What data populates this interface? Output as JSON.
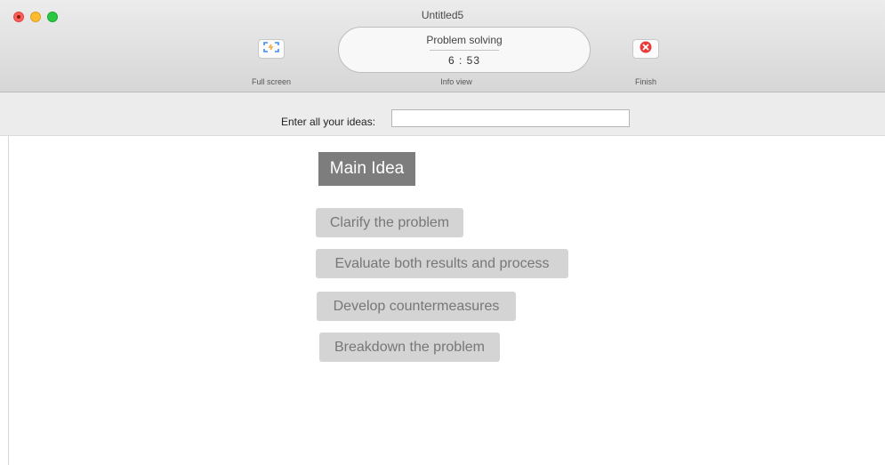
{
  "window": {
    "title": "Untitled5"
  },
  "toolbar": {
    "full_screen_label": "Full screen",
    "info_view_label": "Info view",
    "finish_label": "Finish",
    "info": {
      "title": "Problem solving",
      "timer": "6 : 53"
    }
  },
  "ideas_bar": {
    "label": "Enter all your ideas:",
    "input_value": ""
  },
  "canvas": {
    "main_idea": "Main Idea",
    "ideas": [
      "Clarify the problem",
      "Evaluate both results and process",
      "Develop countermeasures",
      "Breakdown the problem"
    ]
  },
  "colors": {
    "main_idea_bg": "#7d7d7d",
    "idea_bg": "#d4d4d4",
    "finish_icon": "#ea3b3b",
    "fullscreen_icon": "#3b8ef0"
  },
  "icons": {
    "full_screen": "fullscreen-icon",
    "finish": "close-circle-icon"
  }
}
